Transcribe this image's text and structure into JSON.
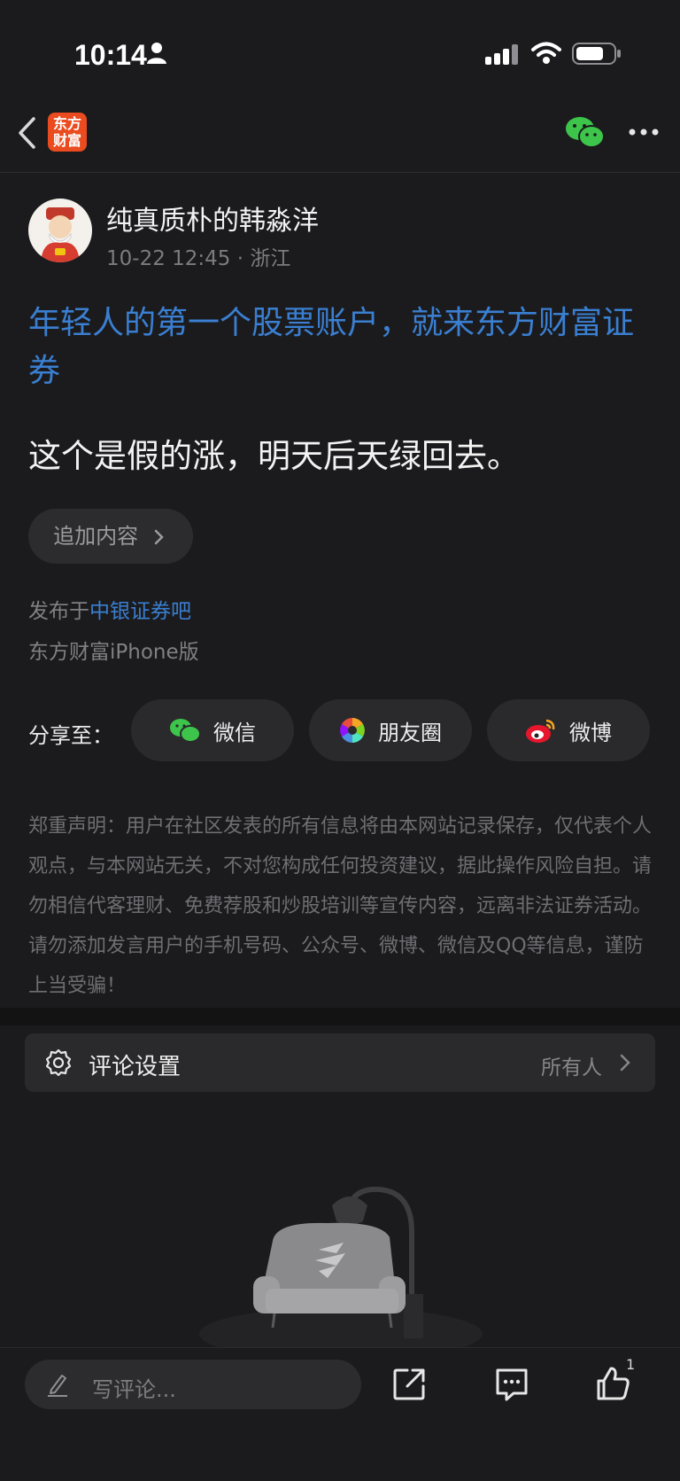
{
  "status_bar": {
    "time": "10:14"
  },
  "nav": {
    "logo_line1": "东方",
    "logo_line2": "财富"
  },
  "author": {
    "name": "纯真质朴的韩淼洋",
    "meta": "10-22 12:45 · 浙江"
  },
  "post": {
    "ad_title": "年轻人的第一个股票账户，就来东方财富证券",
    "body": "这个是假的涨，明天后天绿回去。",
    "add_content_label": "追加内容",
    "published_prefix": "发布于",
    "forum_name": "中银证券吧",
    "client": "东方财富iPhone版"
  },
  "share": {
    "label": "分享至：",
    "targets": [
      {
        "label": "微信",
        "icon": "wechat-icon"
      },
      {
        "label": "朋友圈",
        "icon": "moments-icon"
      },
      {
        "label": "微博",
        "icon": "weibo-icon"
      }
    ]
  },
  "disclaimer": "郑重声明：用户在社区发表的所有信息将由本网站记录保存，仅代表个人观点，与本网站无关，不对您构成任何投资建议，据此操作风险自担。请勿相信代客理财、免费荐股和炒股培训等宣传内容，远离非法证券活动。请勿添加发言用户的手机号码、公众号、微博、微信及QQ等信息，谨防上当受骗！",
  "comment_settings": {
    "label": "评论设置",
    "value": "所有人"
  },
  "bottom_bar": {
    "comment_placeholder": "写评论...",
    "like_count": "1"
  },
  "colors": {
    "background": "#1b1b1d",
    "accent_blue": "#3a7fd1",
    "brand_orange": "#ea4b1f",
    "wechat_green": "#3dc54b"
  }
}
